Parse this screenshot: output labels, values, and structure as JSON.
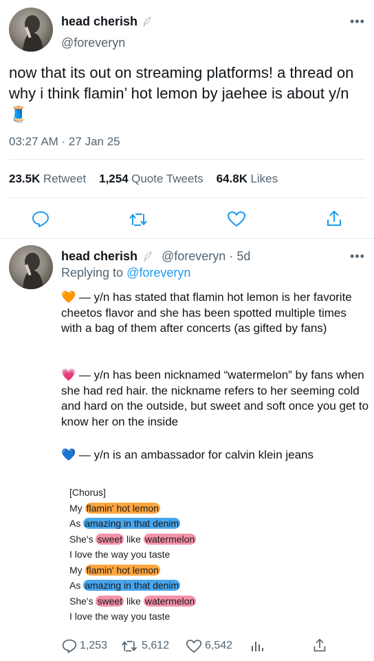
{
  "tweet": {
    "author_name": "head cherish",
    "author_handle": "@foreveryn",
    "text": "now that its out on streaming platforms! a thread on why i think flamin’ hot lemon by jaehee is about y/n",
    "text_emoji": "🧵",
    "timestamp": "03:27 AM · 27 Jan 25",
    "stats": {
      "retweets_num": "23.5K",
      "retweets_label": "Retweet",
      "quotes_num": "1,254",
      "quotes_label": "Quote Tweets",
      "likes_num": "64.8K",
      "likes_label": "Likes"
    }
  },
  "reply": {
    "author_name": "head cherish",
    "author_handle": "@foreveryn",
    "age": "· 5d",
    "replying_prefix": "Replying to",
    "replying_handle": "@foreveryn",
    "paragraphs": [
      {
        "emoji": "🧡",
        "text": "— y/n has stated that flamin hot lemon is her favorite cheetos flavor and she has been spotted multiple times with a bag of them after concerts (as gifted by fans)"
      },
      {
        "emoji": "💗",
        "text": "— y/n has been nicknamed “watermelon” by fans when she had red hair. the nickname refers to her seeming cold and hard on the outside, but sweet and soft once you get to know her on the inside"
      },
      {
        "emoji": "💙",
        "text": "— y/n is an ambassador for calvin klein jeans"
      }
    ],
    "lyrics": {
      "header": "[Chorus]",
      "l1_a": "My ",
      "l1_b": "flamin' hot lemon",
      "l2_a": "As ",
      "l2_b": "amazing in that denim",
      "l3_a": "She's ",
      "l3_b": "sweet",
      "l3_c": " like ",
      "l3_d": "watermelon",
      "l4": "I love the way you taste",
      "l5_a": "My ",
      "l5_b": "flamin' hot lemon",
      "l6_a": "As ",
      "l6_b": "amazing in that denim",
      "l7_a": "She's ",
      "l7_b": "sweet",
      "l7_c": " like ",
      "l7_d": "watermelon",
      "l8": "I love the way you taste"
    },
    "actions": {
      "replies": "1,253",
      "retweets": "5,612",
      "likes": "6,542"
    }
  },
  "icons": {
    "verified": "feather-icon",
    "more": "more-icon",
    "reply": "reply-icon",
    "retweet": "retweet-icon",
    "like": "heart-icon",
    "share": "share-icon",
    "analytics": "analytics-icon"
  },
  "colors": {
    "link": "#1d9bf0",
    "secondary": "#536471",
    "hl_orange": "#ff961e",
    "hl_blue": "#2896eb",
    "hl_pink": "#f06e8c"
  }
}
